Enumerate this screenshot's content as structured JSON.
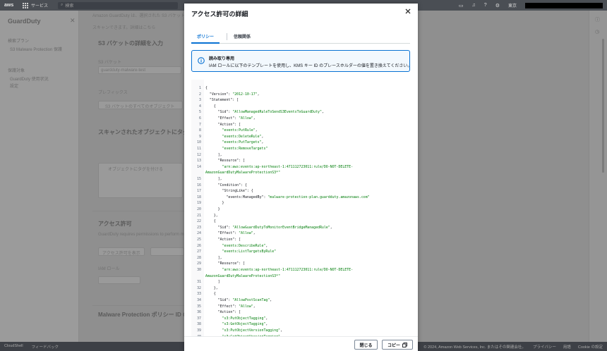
{
  "topbar": {
    "logo": "aws",
    "services_label": "サービス",
    "search_placeholder": "検索",
    "region": "東京"
  },
  "sidenav": {
    "title": "GuardDuty",
    "sections": [
      "検索プラン",
      "S3 Malware Protection 保護",
      "保護対象",
      "GuardDuty 使用状況",
      "設定"
    ]
  },
  "background": {
    "lines": [
      "Amazon GuardDuty は、選択された S3 バケット内にアップロードされる新しいオブジェクトを",
      "スキャンできます。詳細はこちら",
      "S3 バケットの詳細を入力",
      "S3 バケット",
      "guardduty-malware-test",
      "プレフィックス",
      "S3 バケットのすべてのオブジェクト",
      "スキャンされたオブジェクトにタグを付ける",
      "オブジェクトにタグを付ける",
      "アクセス許可",
      "GuardDuty requires permissions to perform malware scans",
      "アクセス許可を表示",
      "IAM ロール",
      "Malware Protection ポリシー ID の詳細"
    ]
  },
  "modal": {
    "title": "アクセス許可の詳細",
    "tabs": [
      {
        "label": "ポリシー"
      },
      {
        "label": "信頼関係"
      }
    ],
    "alert": {
      "title": "読み取り専用",
      "body": "IAM ロールに以下のテンプレートを使用し、KMS キー ID のプレースホルダーの値を置き換えてください。"
    },
    "code_lines": [
      {
        "n": "1",
        "t": "{"
      },
      {
        "n": "2",
        "t": "  \"Version\": \"2012-10-17\","
      },
      {
        "n": "3",
        "t": "  \"Statement\": ["
      },
      {
        "n": "4",
        "t": "    {"
      },
      {
        "n": "5",
        "t": "      \"Sid\": \"AllowManagedRuleToSendS3EventsToGuardDuty\","
      },
      {
        "n": "6",
        "t": "      \"Effect\": \"Allow\","
      },
      {
        "n": "7",
        "t": "      \"Action\": ["
      },
      {
        "n": "8",
        "t": "        \"events:PutRule\","
      },
      {
        "n": "9",
        "t": "        \"events:DeleteRule\","
      },
      {
        "n": "10",
        "t": "        \"events:PutTargets\","
      },
      {
        "n": "11",
        "t": "        \"events:RemoveTargets\""
      },
      {
        "n": "12",
        "t": "      ],"
      },
      {
        "n": "13",
        "t": "      \"Resource\": ["
      },
      {
        "n": "14",
        "t": "        \"arn:aws:events:ap-northeast-1:471112723011:rule/DO-NOT-DELETE-"
      },
      {
        "n": "",
        "t": "AmazonGuardDutyMalwareProtectionS3*\""
      },
      {
        "n": "15",
        "t": "      ],"
      },
      {
        "n": "16",
        "t": "      \"Condition\": {"
      },
      {
        "n": "17",
        "t": "        \"StringLike\": {"
      },
      {
        "n": "18",
        "t": "          \"events:ManagedBy\": \"malware-protection-plan.guardduty.amazonaws.com\""
      },
      {
        "n": "19",
        "t": "        }"
      },
      {
        "n": "20",
        "t": "      }"
      },
      {
        "n": "21",
        "t": "    },"
      },
      {
        "n": "22",
        "t": "    {"
      },
      {
        "n": "23",
        "t": "      \"Sid\": \"AllowGuardDutyToMonitorEventBridgeManagedRule\","
      },
      {
        "n": "24",
        "t": "      \"Effect\": \"Allow\","
      },
      {
        "n": "25",
        "t": "      \"Action\": ["
      },
      {
        "n": "26",
        "t": "        \"events:DescribeRule\","
      },
      {
        "n": "27",
        "t": "        \"events:ListTargetsByRule\""
      },
      {
        "n": "28",
        "t": "      ],"
      },
      {
        "n": "29",
        "t": "      \"Resource\": ["
      },
      {
        "n": "30",
        "t": "        \"arn:aws:events:ap-northeast-1:471112723011:rule/DO-NOT-DELETE-"
      },
      {
        "n": "",
        "t": "AmazonGuardDutyMalwareProtectionS3*\""
      },
      {
        "n": "31",
        "t": "      ]"
      },
      {
        "n": "32",
        "t": "    },"
      },
      {
        "n": "33",
        "t": "    {"
      },
      {
        "n": "34",
        "t": "      \"Sid\": \"AllowPostScanTag\","
      },
      {
        "n": "35",
        "t": "      \"Effect\": \"Allow\","
      },
      {
        "n": "36",
        "t": "      \"Action\": ["
      },
      {
        "n": "37",
        "t": "        \"s3:PutObjectTagging\","
      },
      {
        "n": "38",
        "t": "        \"s3:GetObjectTagging\","
      },
      {
        "n": "39",
        "t": "        \"s3:PutObjectVersionTagging\","
      },
      {
        "n": "40",
        "t": "        \"s3:GetObjectVersionTagging\""
      }
    ],
    "buttons": {
      "close": "閉じる",
      "copy": "コピー"
    }
  },
  "footer": {
    "left": [
      "CloudShell",
      "フィードバック"
    ],
    "right": [
      "© 2024, Amazon Web Services, Inc. またはその関連会社。",
      "プライバシー",
      "用語",
      "Cookie の設定"
    ]
  },
  "colors": {
    "accent": "#0972d3",
    "string": "#037f0c",
    "alert_bg": "#f2f8fd"
  }
}
